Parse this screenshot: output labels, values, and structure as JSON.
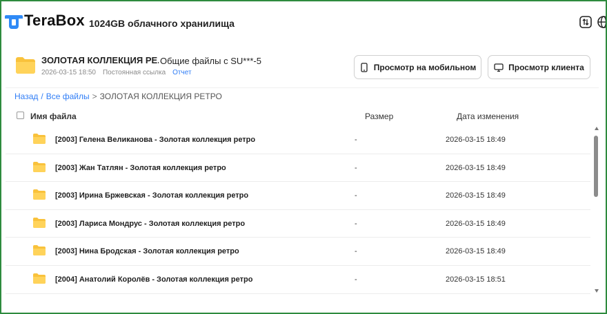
{
  "header": {
    "brand": "TeraBox",
    "storage": "1024GB облачного хранилища"
  },
  "folder": {
    "title": "ЗОЛОТАЯ КОЛЛЕКЦИЯ РЕ...",
    "shared_by": "Общие файлы с SU***-5",
    "date": "2026-03-15 18:50",
    "link_type": "Постоянная ссылка",
    "report": "Отчет"
  },
  "buttons": {
    "mobile": "Просмотр на мобильном",
    "client": "Просмотр клиента"
  },
  "breadcrumb": {
    "back": "Назад",
    "all_files": "Все файлы",
    "current": "ЗОЛОТАЯ КОЛЛЕКЦИЯ РЕТРО"
  },
  "table": {
    "col_name": "Имя файла",
    "col_size": "Размер",
    "col_date": "Дата изменения",
    "rows": [
      {
        "name": "[2003] Гелена Великанова - Золотая коллекция ретро",
        "size": "-",
        "date": "2026-03-15 18:49"
      },
      {
        "name": "[2003] Жан Татлян - Золотая коллекция ретро",
        "size": "-",
        "date": "2026-03-15 18:49"
      },
      {
        "name": "[2003] Ирина Бржевская - Золотая коллекция ретро",
        "size": "-",
        "date": "2026-03-15 18:49"
      },
      {
        "name": "[2003] Лариса Мондрус - Золотая коллекция ретро",
        "size": "-",
        "date": "2026-03-15 18:49"
      },
      {
        "name": "[2003] Нина Бродская - Золотая коллекция ретро",
        "size": "-",
        "date": "2026-03-15 18:49"
      },
      {
        "name": "[2004] Анатолий Королёв - Золотая коллекция ретро",
        "size": "-",
        "date": "2026-03-15 18:51"
      }
    ]
  },
  "colors": {
    "accent": "#2f7df6",
    "folder": "#f9c23c",
    "frame": "#2e8b3e"
  },
  "icons": [
    "terabox-logo-icon",
    "sort-icon",
    "globe-icon",
    "folder-icon",
    "phone-icon",
    "monitor-icon"
  ]
}
